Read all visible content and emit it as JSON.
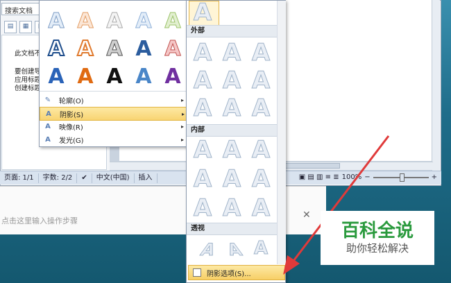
{
  "nav": {
    "search_placeholder": "搜索文档",
    "body_lines": [
      "此文档不",
      "要创建导",
      "应用标题",
      "创建标题"
    ]
  },
  "status": {
    "page": "页面: 1/1",
    "words": "字数: 2/2",
    "language": "中文(中国)",
    "mode": "插入",
    "zoom": "100%",
    "minus": "−",
    "plus": "+"
  },
  "step_tool": {
    "input_placeholder": "点击这里输入操作步骤",
    "close": "✕"
  },
  "menu": {
    "gallery_letter": "A",
    "items": [
      {
        "label": "轮廓(O)",
        "icon": "outline-icon"
      },
      {
        "label": "阴影(S)",
        "icon": "shadow-icon"
      },
      {
        "label": "映像(R)",
        "icon": "reflection-icon"
      },
      {
        "label": "发光(G)",
        "icon": "glow-icon"
      }
    ]
  },
  "shadow_submenu": {
    "letter": "A",
    "sections": [
      "外部",
      "内部",
      "透视"
    ],
    "footer_label": "阴影选项(S)..."
  },
  "watermark": {
    "title": "百科全说",
    "subtitle": "助你轻松解决"
  },
  "colors": {
    "accent_highlight": "#f8d472",
    "watermark_green": "#2a9a3d",
    "arrow_red": "#e03a3a"
  }
}
